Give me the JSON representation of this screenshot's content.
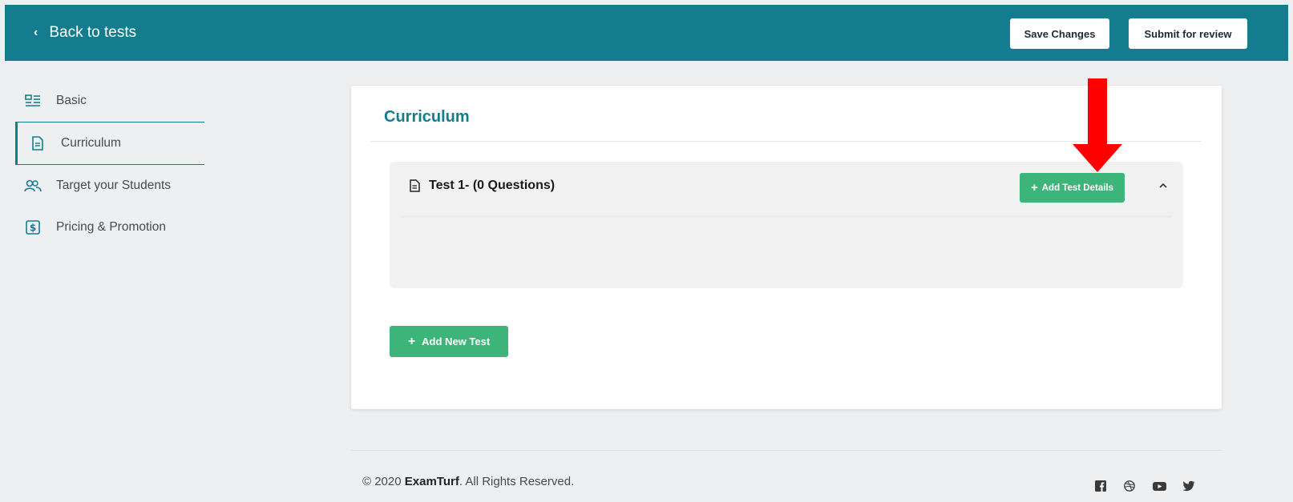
{
  "topbar": {
    "back_label": "Back to tests",
    "save_label": "Save Changes",
    "submit_label": "Submit for review"
  },
  "sidebar": {
    "items": [
      {
        "label": "Basic",
        "icon": "basic-list-icon"
      },
      {
        "label": "Curriculum",
        "icon": "document-icon"
      },
      {
        "label": "Target your Students",
        "icon": "users-icon"
      },
      {
        "label": "Pricing & Promotion",
        "icon": "dollar-icon"
      }
    ]
  },
  "main": {
    "title": "Curriculum",
    "test_title": "Test 1- (0 Questions)",
    "add_details_label": "Add Test Details",
    "add_test_label": "Add New Test"
  },
  "footer": {
    "copyright_prefix": "© 2020 ",
    "brand": "ExamTurf",
    "copyright_suffix": ". All Rights Reserved.",
    "social": [
      "facebook-icon",
      "dribbble-icon",
      "youtube-icon",
      "twitter-icon"
    ]
  },
  "colors": {
    "primary": "#137d8f",
    "green": "#3db57a",
    "annotation_arrow": "#ff0000"
  }
}
